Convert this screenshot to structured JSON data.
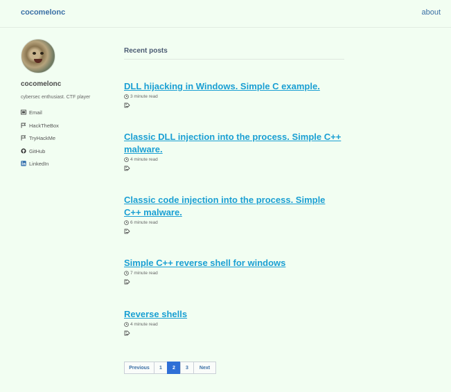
{
  "header": {
    "site_title": "cocomelonc",
    "nav_about": "about"
  },
  "sidebar": {
    "author_name": "cocomelonc",
    "bio": "cybersec enthusiast. CTF player",
    "links": [
      {
        "label": "Email",
        "icon": "envelope-icon"
      },
      {
        "label": "HackTheBox",
        "icon": "flag-icon"
      },
      {
        "label": "TryHackMe",
        "icon": "flag-icon"
      },
      {
        "label": "GitHub",
        "icon": "github-icon"
      },
      {
        "label": "LinkedIn",
        "icon": "linkedin-icon"
      }
    ]
  },
  "main": {
    "section_title": "Recent posts",
    "posts": [
      {
        "title": "DLL hijacking in Windows. Simple C example.",
        "read_time": "3 minute read"
      },
      {
        "title": "Classic DLL injection into the process. Simple C++ malware.",
        "read_time": "4 minute read"
      },
      {
        "title": "Classic code injection into the process. Simple C++ malware.",
        "read_time": "6 minute read"
      },
      {
        "title": "Simple C++ reverse shell for windows",
        "read_time": "7 minute read"
      },
      {
        "title": "Reverse shells",
        "read_time": "4 minute read"
      }
    ]
  },
  "pagination": {
    "previous": "Previous",
    "pages": [
      "1",
      "2",
      "3"
    ],
    "current": "2",
    "next": "Next"
  },
  "colors": {
    "background": "#f2fef2",
    "link": "#1a9fd3",
    "accent": "#2f6fd6"
  }
}
